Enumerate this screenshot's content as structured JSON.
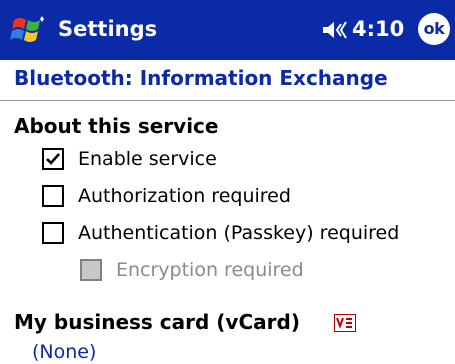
{
  "titlebar": {
    "title": "Settings",
    "time": "4:10",
    "ok_label": "ok",
    "start_icon": "windows-flag-icon",
    "volume_icon": "speaker-volume-icon"
  },
  "page": {
    "header": "Bluetooth: Information Exchange"
  },
  "about_section": {
    "heading": "About this service",
    "options": [
      {
        "label": "Enable service",
        "checked": true,
        "enabled": true
      },
      {
        "label": "Authorization required",
        "checked": false,
        "enabled": true
      },
      {
        "label": "Authentication (Passkey) required",
        "checked": false,
        "enabled": true
      },
      {
        "label": "Encryption required",
        "checked": false,
        "enabled": false
      }
    ]
  },
  "vcard_section": {
    "heading": "My business card (vCard)",
    "icon": "vcard-icon",
    "value": "(None)"
  },
  "colors": {
    "titlebar_bg": "#0a2aa8",
    "accent_text": "#0a2aa8",
    "disabled_text": "#8a8a8a"
  }
}
